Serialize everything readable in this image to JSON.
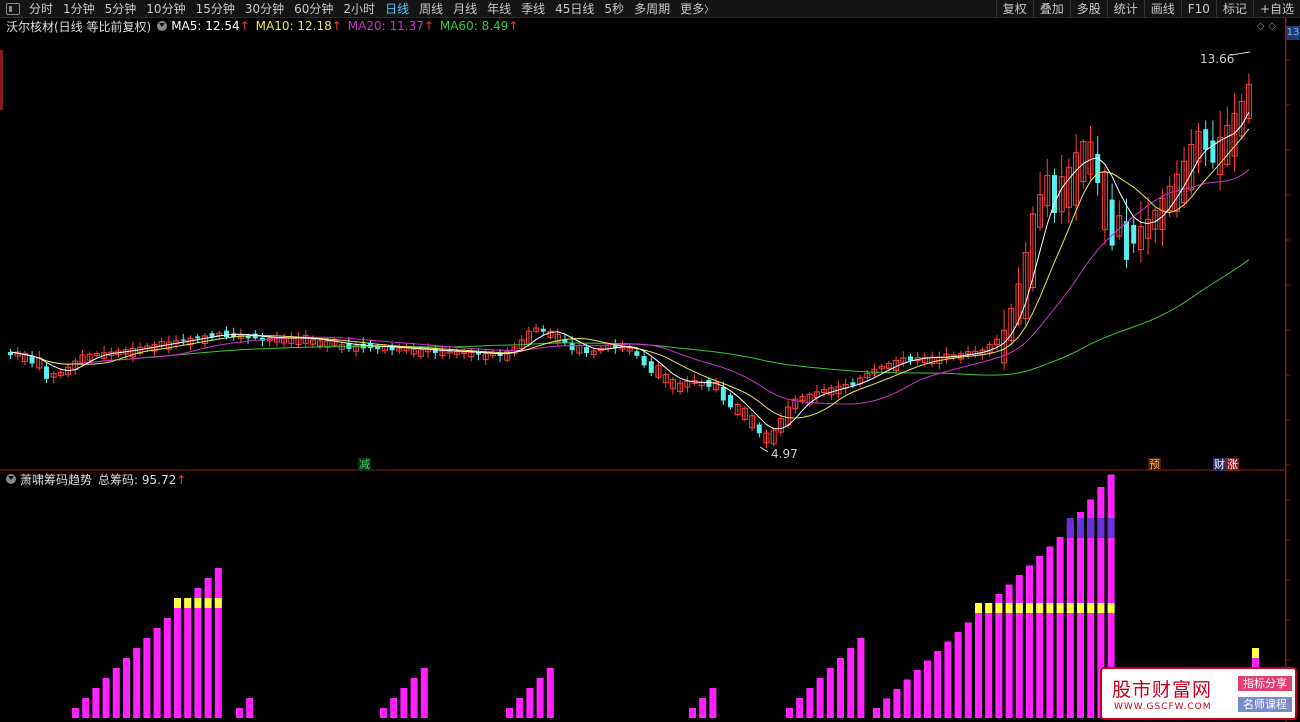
{
  "toolbar": {
    "periods": [
      "分时",
      "1分钟",
      "5分钟",
      "10分钟",
      "15分钟",
      "30分钟",
      "60分钟",
      "2小时",
      "日线",
      "周线",
      "月线",
      "年线",
      "季线",
      "45日线",
      "5秒",
      "多周期",
      "更多"
    ],
    "active_period": "日线",
    "more_suffix": "〉",
    "right_buttons": [
      "复权",
      "叠加",
      "多股",
      "统计",
      "画线",
      "F10",
      "标记",
      "+自选"
    ]
  },
  "header": {
    "stock_title": "沃尔核材(日线 等比前复权)",
    "ma5": "MA5: 12.54",
    "ma10": "MA10: 12.18",
    "ma20": "MA20: 11.37",
    "ma60": "MA60: 8.49",
    "up_arrow": "↑",
    "side_tag": "13",
    "corner_icons": "◇◇"
  },
  "colors": {
    "ma5": "#ffffff",
    "ma10": "#e8e85a",
    "ma20": "#d030d0",
    "ma60": "#3cc83c",
    "up_candle": "#ff4040",
    "down_candle": "#55f0f0",
    "chip_bar": "#ff22ff",
    "chip_yellow": "#ffff44",
    "chip_blue": "#6633dd"
  },
  "price": {
    "high_label": "13.66",
    "low_label": "4.97"
  },
  "markers": {
    "jian": "减",
    "yu": "预",
    "cai": "财",
    "zhang": "涨"
  },
  "indicator": {
    "name": "萧啸筹码趋势",
    "total_label": "总筹码: 95.72",
    "up_arrow": "↑"
  },
  "watermark": {
    "title": "股市财富网",
    "url": "WWW.GSCFW.COM",
    "tag1": "指标分享",
    "tag2": "名师课程"
  }
}
